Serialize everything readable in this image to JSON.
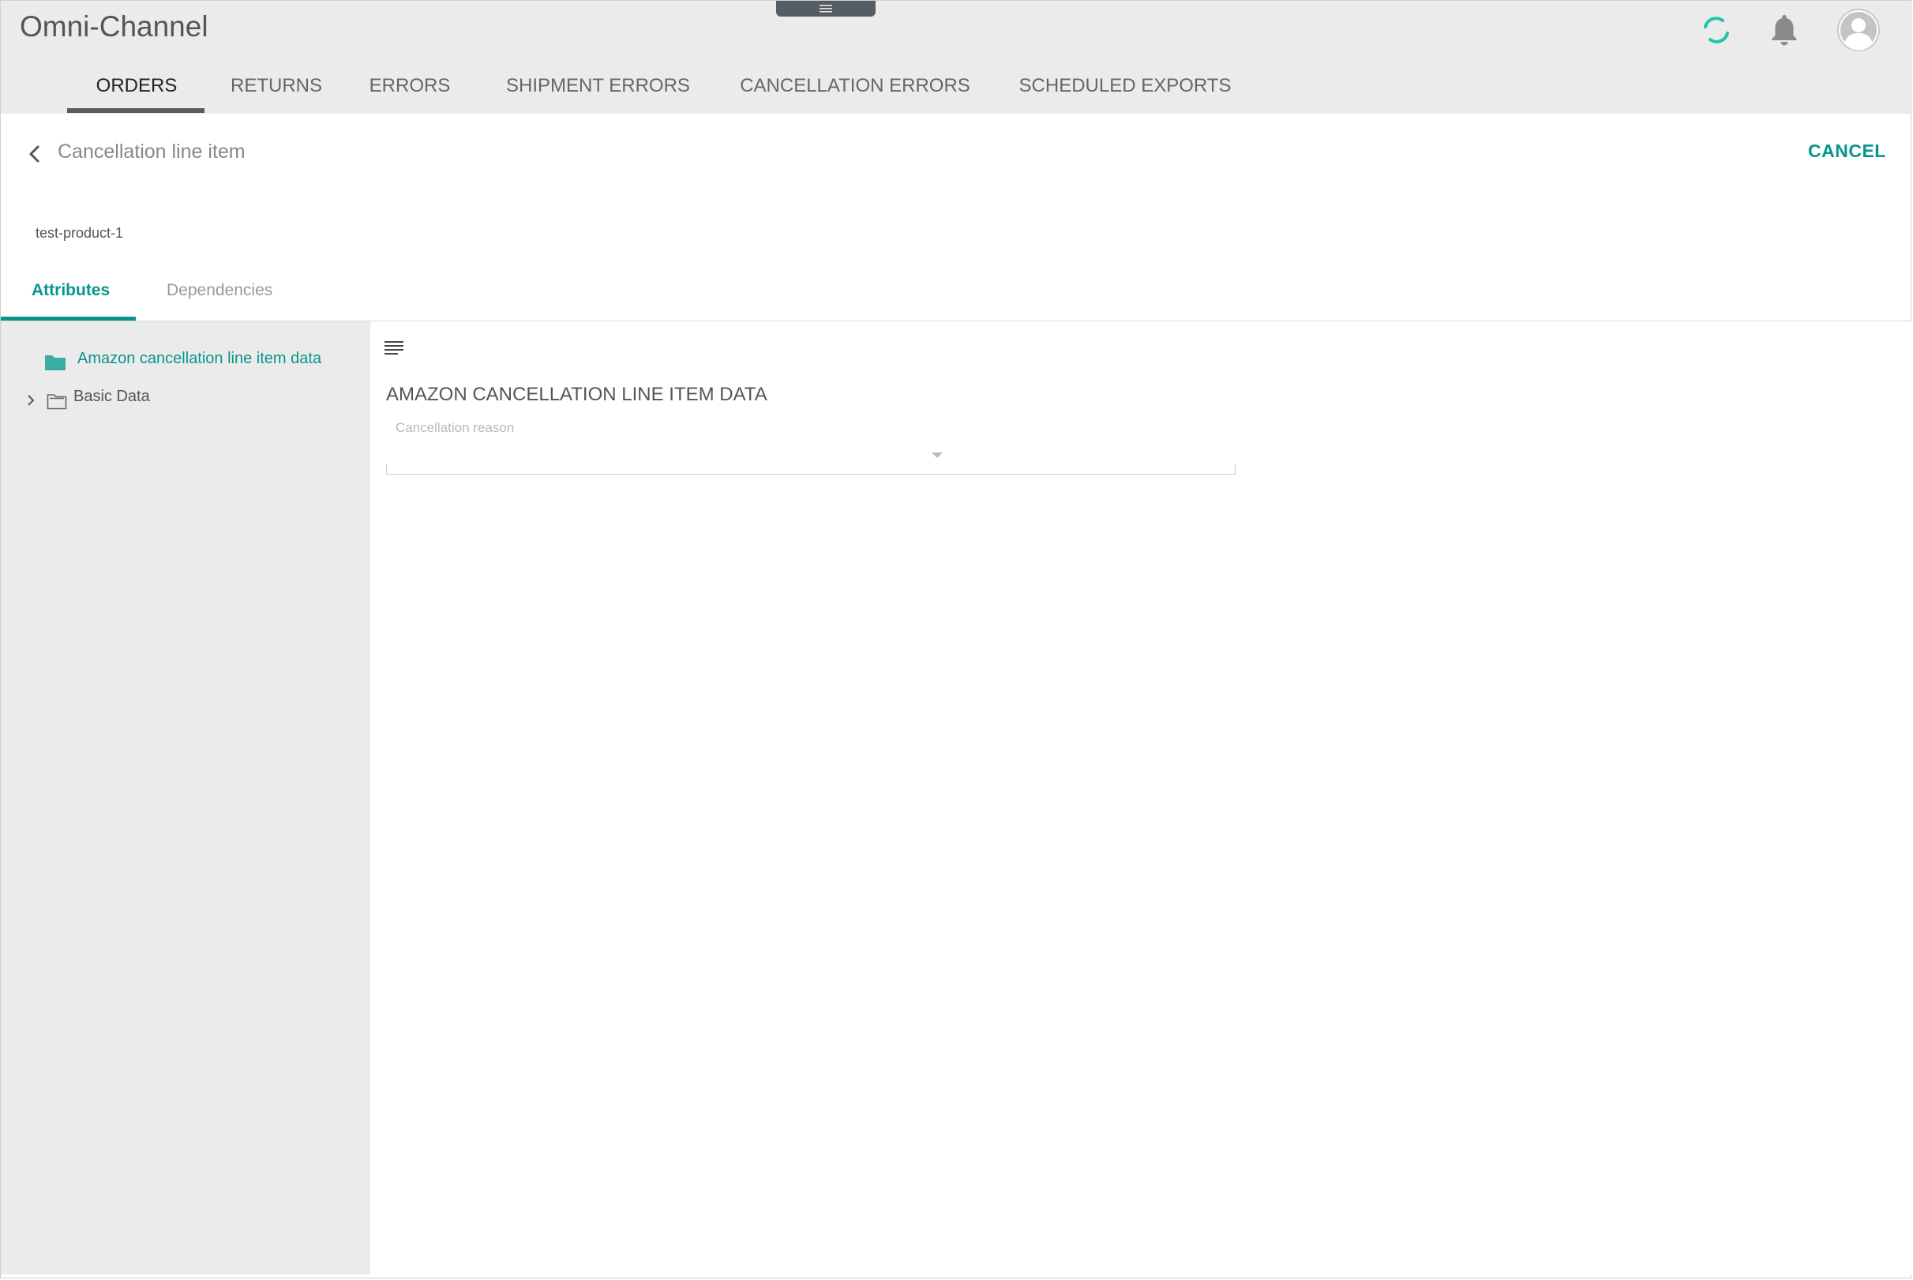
{
  "app": {
    "title": "Omni-Channel"
  },
  "nav": {
    "tabs": [
      {
        "label": "ORDERS",
        "active": true
      },
      {
        "label": "RETURNS"
      },
      {
        "label": "ERRORS"
      },
      {
        "label": "SHIPMENT ERRORS"
      },
      {
        "label": "CANCELLATION ERRORS"
      },
      {
        "label": "SCHEDULED EXPORTS"
      }
    ]
  },
  "page": {
    "title": "Cancellation line item",
    "cancel_label": "CANCEL",
    "product_id": "test-product-1"
  },
  "subtabs": [
    {
      "label": "Attributes",
      "active": true
    },
    {
      "label": "Dependencies"
    }
  ],
  "tree": {
    "items": [
      {
        "label": "Amazon cancellation line item data",
        "selected": true,
        "icon": "folder-icon"
      },
      {
        "label": "Basic Data",
        "icon": "folder-outline-icon"
      }
    ]
  },
  "form": {
    "section_title": "AMAZON CANCELLATION LINE ITEM DATA",
    "fields": [
      {
        "label": "Cancellation reason",
        "value": ""
      }
    ]
  },
  "colors": {
    "accent": "#08948b",
    "header_bg": "#ebebeb",
    "indicator": "#555d63"
  }
}
